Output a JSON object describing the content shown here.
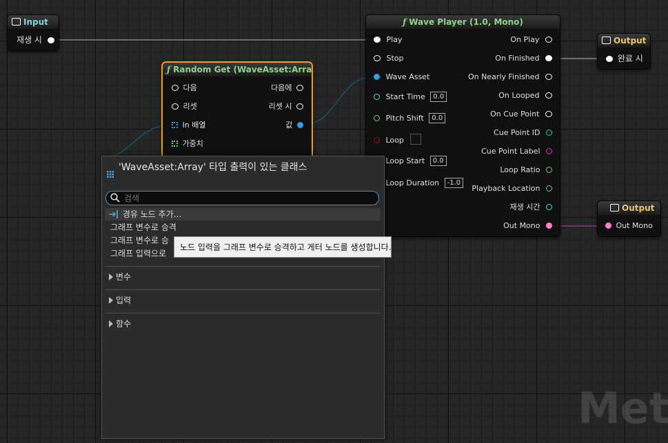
{
  "input_node": {
    "title": "Input",
    "pin_label": "재생 시"
  },
  "random_get": {
    "title": "Random Get (WaveAsset:Array)",
    "pins_left": [
      "다음",
      "리셋",
      "In 배열",
      "가중치"
    ],
    "pins_right": [
      "다음에",
      "리셋 시",
      "값"
    ]
  },
  "wave_player": {
    "title": "Wave Player (1.0, Mono)",
    "inputs": [
      {
        "label": "Play"
      },
      {
        "label": "Stop"
      },
      {
        "label": "Wave Asset"
      },
      {
        "label": "Start Time",
        "value": "0.0"
      },
      {
        "label": "Pitch Shift",
        "value": "0.0"
      },
      {
        "label": "Loop"
      },
      {
        "label": "Loop Start",
        "value": "0.0"
      },
      {
        "label": "Loop Duration",
        "value": "-1.0"
      }
    ],
    "outputs": [
      "On Play",
      "On Finished",
      "On Nearly Finished",
      "On Looped",
      "On Cue Point",
      "Cue Point ID",
      "Cue Point Label",
      "Loop Ratio",
      "Playback Location",
      "재생 시간",
      "Out Mono"
    ]
  },
  "output_node_1": {
    "title": "Output",
    "pin_label": "완료 시"
  },
  "output_node_2": {
    "title": "Output",
    "pin_label": "Out Mono"
  },
  "context_menu": {
    "title": "'WaveAsset:Array' 타입 출력이 있는 클래스",
    "search_placeholder": "검색",
    "items": [
      "경유 노드 추가...",
      "그래프 변수로 승격",
      "그래프 변수로 승",
      "그래프 입력으로"
    ],
    "categories": [
      "변수",
      "입력",
      "함수"
    ]
  },
  "tooltip": {
    "text": "노드 입력을 그래프 변수로 승격하고 게터 노드를 생성합니다."
  },
  "watermark": {
    "text": "MetaS"
  },
  "colors": {
    "canvas": "#262626",
    "highlight_border": "#f0a020",
    "float_pin": "#7dc97a",
    "wave_pin": "#2aa0e0",
    "time_pin": "#6fcfe0",
    "bool_pin": "#a01010",
    "string_pin": "#d040c0",
    "audio_pin": "#ff80d0"
  }
}
